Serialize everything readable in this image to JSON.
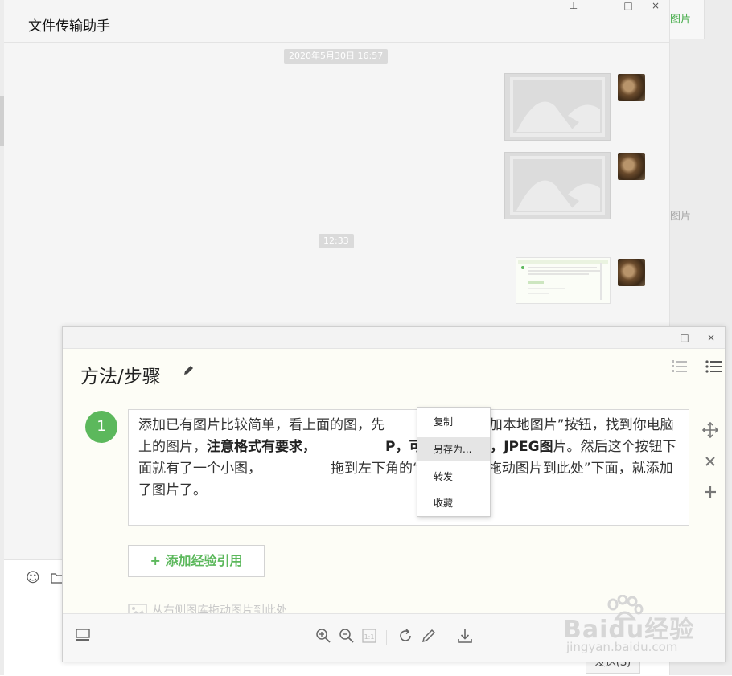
{
  "right_panel": {
    "label_top": "图片",
    "label_mid": "图片"
  },
  "chat": {
    "title": "文件传输助手",
    "timestamp_1": "2020年5月30日 16:57",
    "timestamp_2": "12:33",
    "send_label": "发送(S)",
    "window_controls": {
      "pin": "⊥",
      "minimize": "—",
      "maximize": "□",
      "close": "×"
    }
  },
  "editor": {
    "window_controls": {
      "minimize": "—",
      "maximize": "□",
      "close": "×"
    },
    "step_title": "方法/步骤",
    "step_number": "1",
    "step_text_parts": {
      "p1": "添加已有图片比较简单，看上面的图，先",
      "p2": "角的“添加本地图片”按钮，找到你电脑上的图片，",
      "p3": "注意格式有要求，",
      "p4": "P，可以添加JPG，JPEG图",
      "p5": "片。然后这个按钮下面就有了一个小图，",
      "p6": "拖到左下角的“从右侧图库拖动图片到此处”下面，就添加了图片了。"
    },
    "add_reference": "+ 添加经验引用",
    "drag_hint": "从右侧图库拖动图片到此处"
  },
  "context_menu": {
    "items": [
      "复制",
      "另存为...",
      "转发",
      "收藏"
    ],
    "highlighted": "另存为..."
  },
  "watermark": {
    "logo": "Baidu经验",
    "url": "jingyan.baidu.com"
  },
  "colors": {
    "accent_green": "#5cb85c",
    "chat_bg": "#f5f5f5",
    "editor_bg": "#fdfdf6"
  }
}
